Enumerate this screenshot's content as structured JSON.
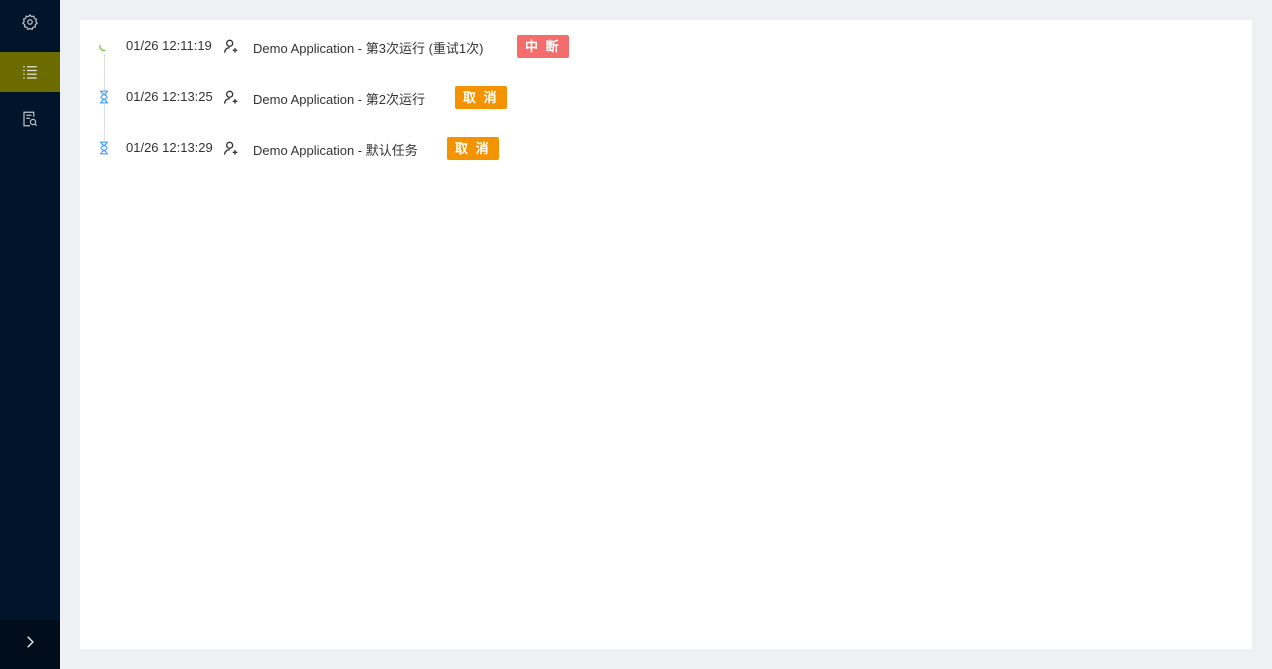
{
  "sidebar": {
    "items": [
      {
        "icon": "gear-icon",
        "active": false
      },
      {
        "icon": "list-icon",
        "active": true
      },
      {
        "icon": "search-document-icon",
        "active": false
      }
    ],
    "active_color": "#6b6b00",
    "background": "#001529",
    "expand_icon": "chevron-right-icon"
  },
  "runs": [
    {
      "status_icon": "loading-icon",
      "time": "01/26 12:11:19",
      "user_icon": "user-add-icon",
      "name": "Demo Application - 第3次运行 (重试1次)",
      "badge": "中 断",
      "badge_color": "#f56c6c"
    },
    {
      "status_icon": "hourglass-icon",
      "time": "01/26 12:13:25",
      "user_icon": "user-add-icon",
      "name": "Demo Application - 第2次运行",
      "badge": "取 消",
      "badge_color": "#f39300"
    },
    {
      "status_icon": "hourglass-icon",
      "time": "01/26 12:13:29",
      "user_icon": "user-add-icon",
      "name": "Demo Application - 默认任务",
      "badge": "取 消",
      "badge_color": "#f39300"
    }
  ]
}
